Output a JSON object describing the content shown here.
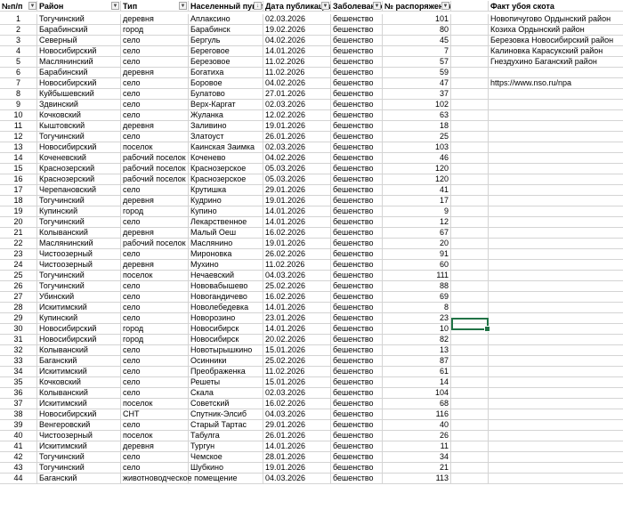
{
  "columns": {
    "a": "№п/п",
    "b": "Район",
    "c": "Тип",
    "d": "Населенный пункт",
    "e": "Дата публикации",
    "f": "Заболевание",
    "g": "№ распоряжения",
    "i": "Факт убоя скота"
  },
  "notes": [
    "Новопичугово Ордынский район",
    "Козиха Ордынский район",
    "Березовка Новосибирский район",
    "Калиновка Карасукский район",
    "Гнездухино Баганский район",
    "",
    "https://www.nso.ru/npa"
  ],
  "rows": [
    [
      "1",
      "Тогучинский",
      "деревня",
      "Аплаксино",
      "02.03.2026",
      "бешенство",
      "101"
    ],
    [
      "2",
      "Барабинский",
      "город",
      "Барабинск",
      "19.02.2026",
      "бешенство",
      "80"
    ],
    [
      "3",
      "Северный",
      "село",
      "Бергуль",
      "04.02.2026",
      "бешенство",
      "45"
    ],
    [
      "4",
      "Новосибирский",
      "село",
      "Береговое",
      "14.01.2026",
      "бешенство",
      "7"
    ],
    [
      "5",
      "Маслянинский",
      "село",
      "Березовое",
      "11.02.2026",
      "бешенство",
      "57"
    ],
    [
      "6",
      "Барабинский",
      "деревня",
      "Богатиха",
      "11.02.2026",
      "бешенство",
      "59"
    ],
    [
      "7",
      "Новосибирский",
      "село",
      "Боровое",
      "04.02.2026",
      "бешенство",
      "47"
    ],
    [
      "8",
      "Куйбышевский",
      "село",
      "Булатово",
      "27.01.2026",
      "бешенство",
      "37"
    ],
    [
      "9",
      "Здвинский",
      "село",
      "Верх-Каргат",
      "02.03.2026",
      "бешенство",
      "102"
    ],
    [
      "10",
      "Кочковский",
      "село",
      "Жуланка",
      "12.02.2026",
      "бешенство",
      "63"
    ],
    [
      "11",
      "Кыштовский",
      "деревня",
      "Заливино",
      "19.01.2026",
      "бешенство",
      "18"
    ],
    [
      "12",
      "Тогучинский",
      "село",
      "Златоуст",
      "26.01.2026",
      "бешенство",
      "25"
    ],
    [
      "13",
      "Новосибирский",
      "поселок",
      "Каинская Заимка",
      "02.03.2026",
      "бешенство",
      "103"
    ],
    [
      "14",
      "Коченевский",
      "рабочий поселок",
      "Коченево",
      "04.02.2026",
      "бешенство",
      "46"
    ],
    [
      "15",
      "Краснозерский",
      "рабочий поселок",
      "Краснозерское",
      "05.03.2026",
      "бешенство",
      "120"
    ],
    [
      "16",
      "Краснозерский",
      "рабочий поселок",
      "Краснозерское",
      "05.03.2026",
      "бешенство",
      "120"
    ],
    [
      "17",
      "Черепановский",
      "село",
      "Крутишка",
      "29.01.2026",
      "бешенство",
      "41"
    ],
    [
      "18",
      "Тогучинский",
      "деревня",
      "Кудрино",
      "19.01.2026",
      "бешенство",
      "17"
    ],
    [
      "19",
      "Купинский",
      "город",
      "Купино",
      "14.01.2026",
      "бешенство",
      "9"
    ],
    [
      "20",
      "Тогучинский",
      "село",
      "Лекарственное",
      "14.01.2026",
      "бешенство",
      "12"
    ],
    [
      "21",
      "Колыванский",
      "деревня",
      "Малый Оеш",
      "16.02.2026",
      "бешенство",
      "67"
    ],
    [
      "22",
      "Маслянинский",
      "рабочий поселок",
      "Маслянино",
      "19.01.2026",
      "бешенство",
      "20"
    ],
    [
      "23",
      "Чистоозерный",
      "село",
      "Мироновка",
      "26.02.2026",
      "бешенство",
      "91"
    ],
    [
      "24",
      "Чистоозерный",
      "деревня",
      "Мухино",
      "11.02.2026",
      "бешенство",
      "60"
    ],
    [
      "25",
      "Тогучинский",
      "поселок",
      "Нечаевский",
      "04.03.2026",
      "бешенство",
      "111"
    ],
    [
      "26",
      "Тогучинский",
      "село",
      "Нововабышево",
      "25.02.2026",
      "бешенство",
      "88"
    ],
    [
      "27",
      "Убинский",
      "село",
      "Новогандичево",
      "16.02.2026",
      "бешенство",
      "69"
    ],
    [
      "28",
      "Искитимский",
      "село",
      "Новолебедевка",
      "14.01.2026",
      "бешенство",
      "8"
    ],
    [
      "29",
      "Купинский",
      "село",
      "Новорозино",
      "23.01.2026",
      "бешенство",
      "23"
    ],
    [
      "30",
      "Новосибирский",
      "город",
      "Новосибирск",
      "14.01.2026",
      "бешенство",
      "10"
    ],
    [
      "31",
      "Новосибирский",
      "город",
      "Новосибирск",
      "20.02.2026",
      "бешенство",
      "82"
    ],
    [
      "32",
      "Колыванский",
      "село",
      "Новотырышкино",
      "15.01.2026",
      "бешенство",
      "13"
    ],
    [
      "33",
      "Баганский",
      "село",
      "Осинники",
      "25.02.2026",
      "бешенство",
      "87"
    ],
    [
      "34",
      "Искитимский",
      "село",
      "Преображенка",
      "11.02.2026",
      "бешенство",
      "61"
    ],
    [
      "35",
      "Кочковский",
      "село",
      "Решеты",
      "15.01.2026",
      "бешенство",
      "14"
    ],
    [
      "36",
      "Колыванский",
      "село",
      "Скала",
      "02.03.2026",
      "бешенство",
      "104"
    ],
    [
      "37",
      "Искитимский",
      "поселок",
      "Советский",
      "16.02.2026",
      "бешенство",
      "68"
    ],
    [
      "38",
      "Новосибирский",
      "СНТ",
      "Спутник-Элсиб",
      "04.03.2026",
      "бешенство",
      "116"
    ],
    [
      "39",
      "Венгеровский",
      "село",
      "Старый Тартас",
      "29.01.2026",
      "бешенство",
      "40"
    ],
    [
      "40",
      "Чистоозерный",
      "поселок",
      "Табулга",
      "26.01.2026",
      "бешенство",
      "26"
    ],
    [
      "41",
      "Искитимский",
      "деревня",
      "Тургун",
      "14.01.2026",
      "бешенство",
      "11"
    ],
    [
      "42",
      "Тогучинский",
      "село",
      "Чемское",
      "28.01.2026",
      "бешенство",
      "34"
    ],
    [
      "43",
      "Тогучинский",
      "село",
      "Шубкино",
      "19.01.2026",
      "бешенство",
      "21"
    ],
    [
      "44",
      "Баганский",
      "животноводческое помещение",
      "",
      "04.03.2026",
      "бешенство",
      "113"
    ]
  ]
}
